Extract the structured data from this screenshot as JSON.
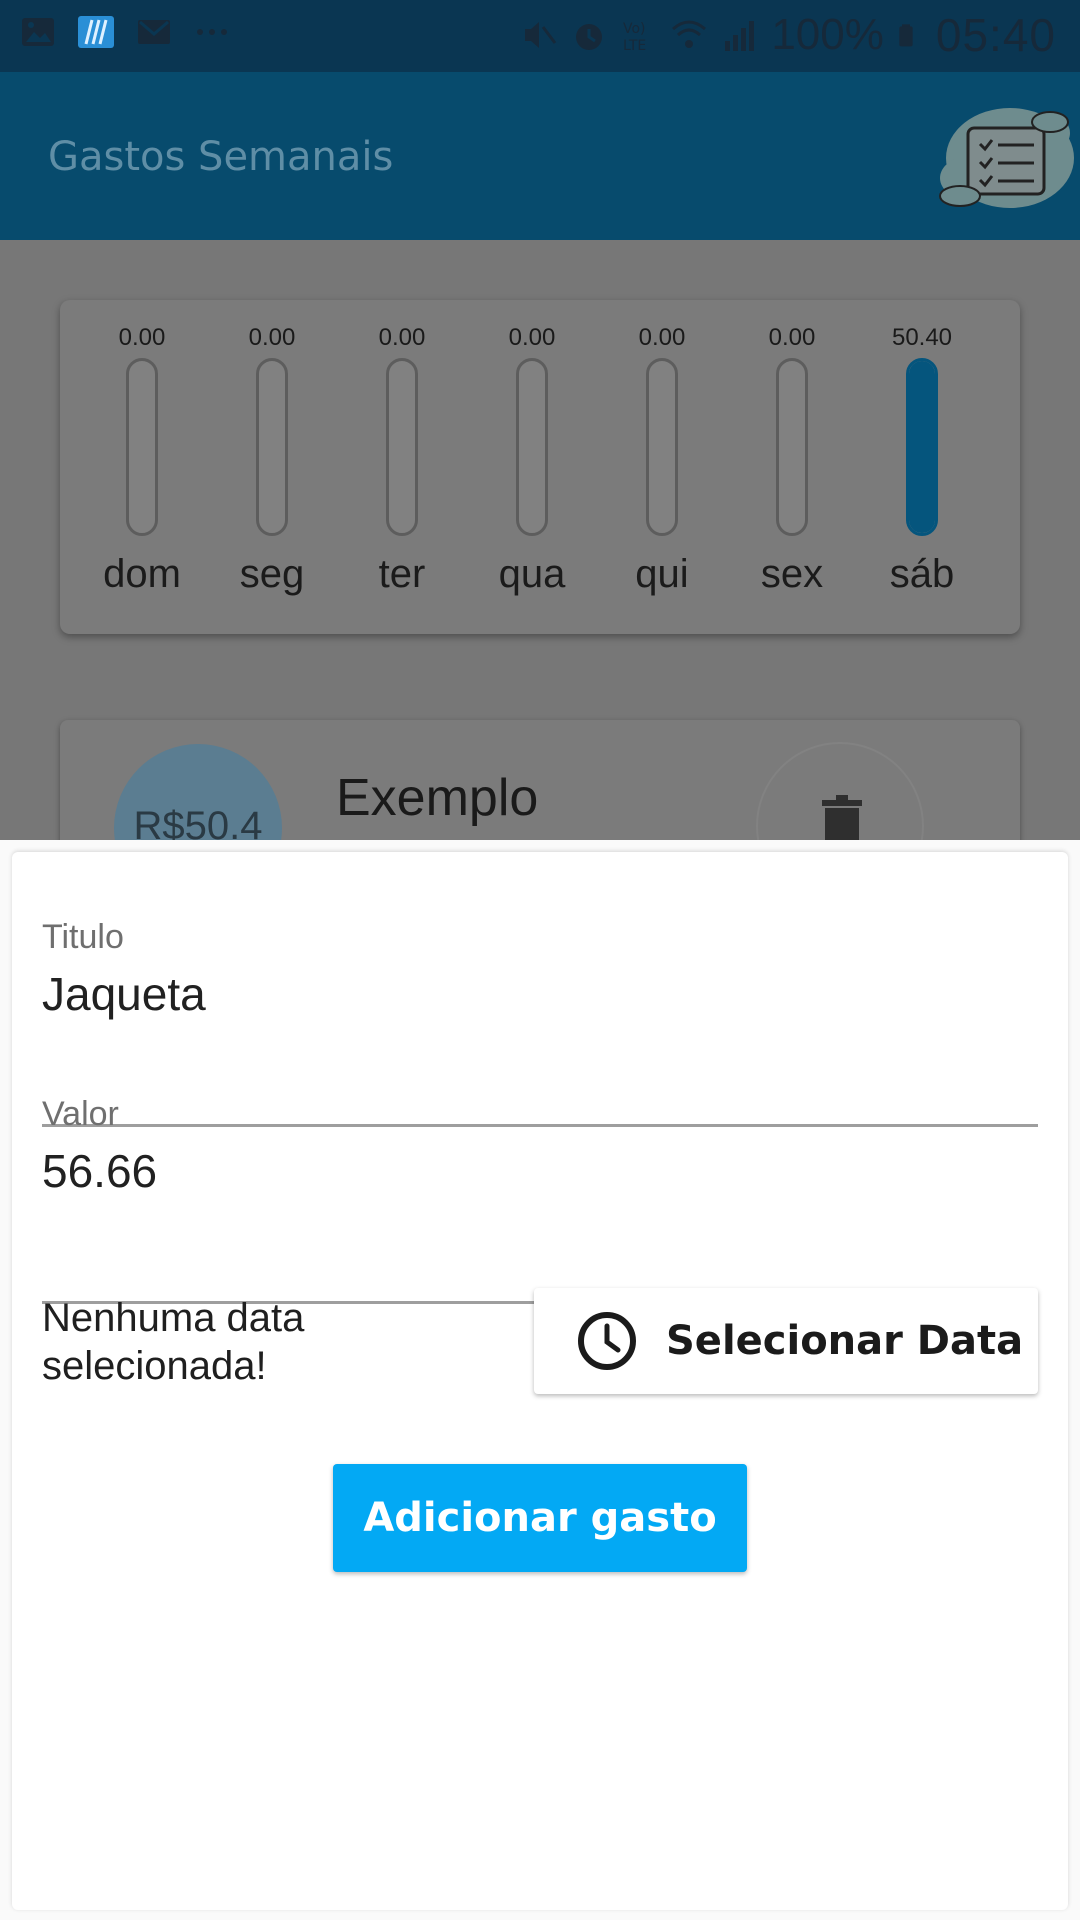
{
  "status_bar": {
    "battery": "100%",
    "time": "05:40",
    "icons_left": [
      "gallery-icon",
      "app-icon",
      "mail-icon",
      "more-icon"
    ],
    "icons_right": [
      "mute-icon",
      "alarm-icon",
      "volte-icon",
      "wifi-icon",
      "signal-icon",
      "battery-icon"
    ]
  },
  "app_bar": {
    "title": "Gastos Semanais",
    "logo_icon": "checklist-cloud-icon"
  },
  "chart_data": {
    "type": "bar",
    "categories": [
      "dom",
      "seg",
      "ter",
      "qua",
      "qui",
      "sex",
      "sáb"
    ],
    "value_labels": [
      "0.00",
      "0.00",
      "0.00",
      "0.00",
      "0.00",
      "0.00",
      "50.40"
    ],
    "values": [
      0,
      0,
      0,
      0,
      0,
      0,
      50.4
    ],
    "fill_fraction": [
      0,
      0,
      0,
      0,
      0,
      0,
      1
    ],
    "colors": {
      "fill": "#05557d",
      "track": "#818181"
    }
  },
  "expense": {
    "amount": "R$50.4",
    "title": "Exemplo",
    "delete_icon": "trash-icon"
  },
  "form": {
    "title_label": "Titulo",
    "title_value": "Jaqueta",
    "value_label": "Valor",
    "value_value": "56.66",
    "date_status": "Nenhuma data selecionada!",
    "select_date_label": "Selecionar Data",
    "add_label": "Adicionar gasto"
  },
  "colors": {
    "primary": "#03a9f4",
    "appbar": "#074b6d",
    "accent_dark": "#05557d"
  }
}
